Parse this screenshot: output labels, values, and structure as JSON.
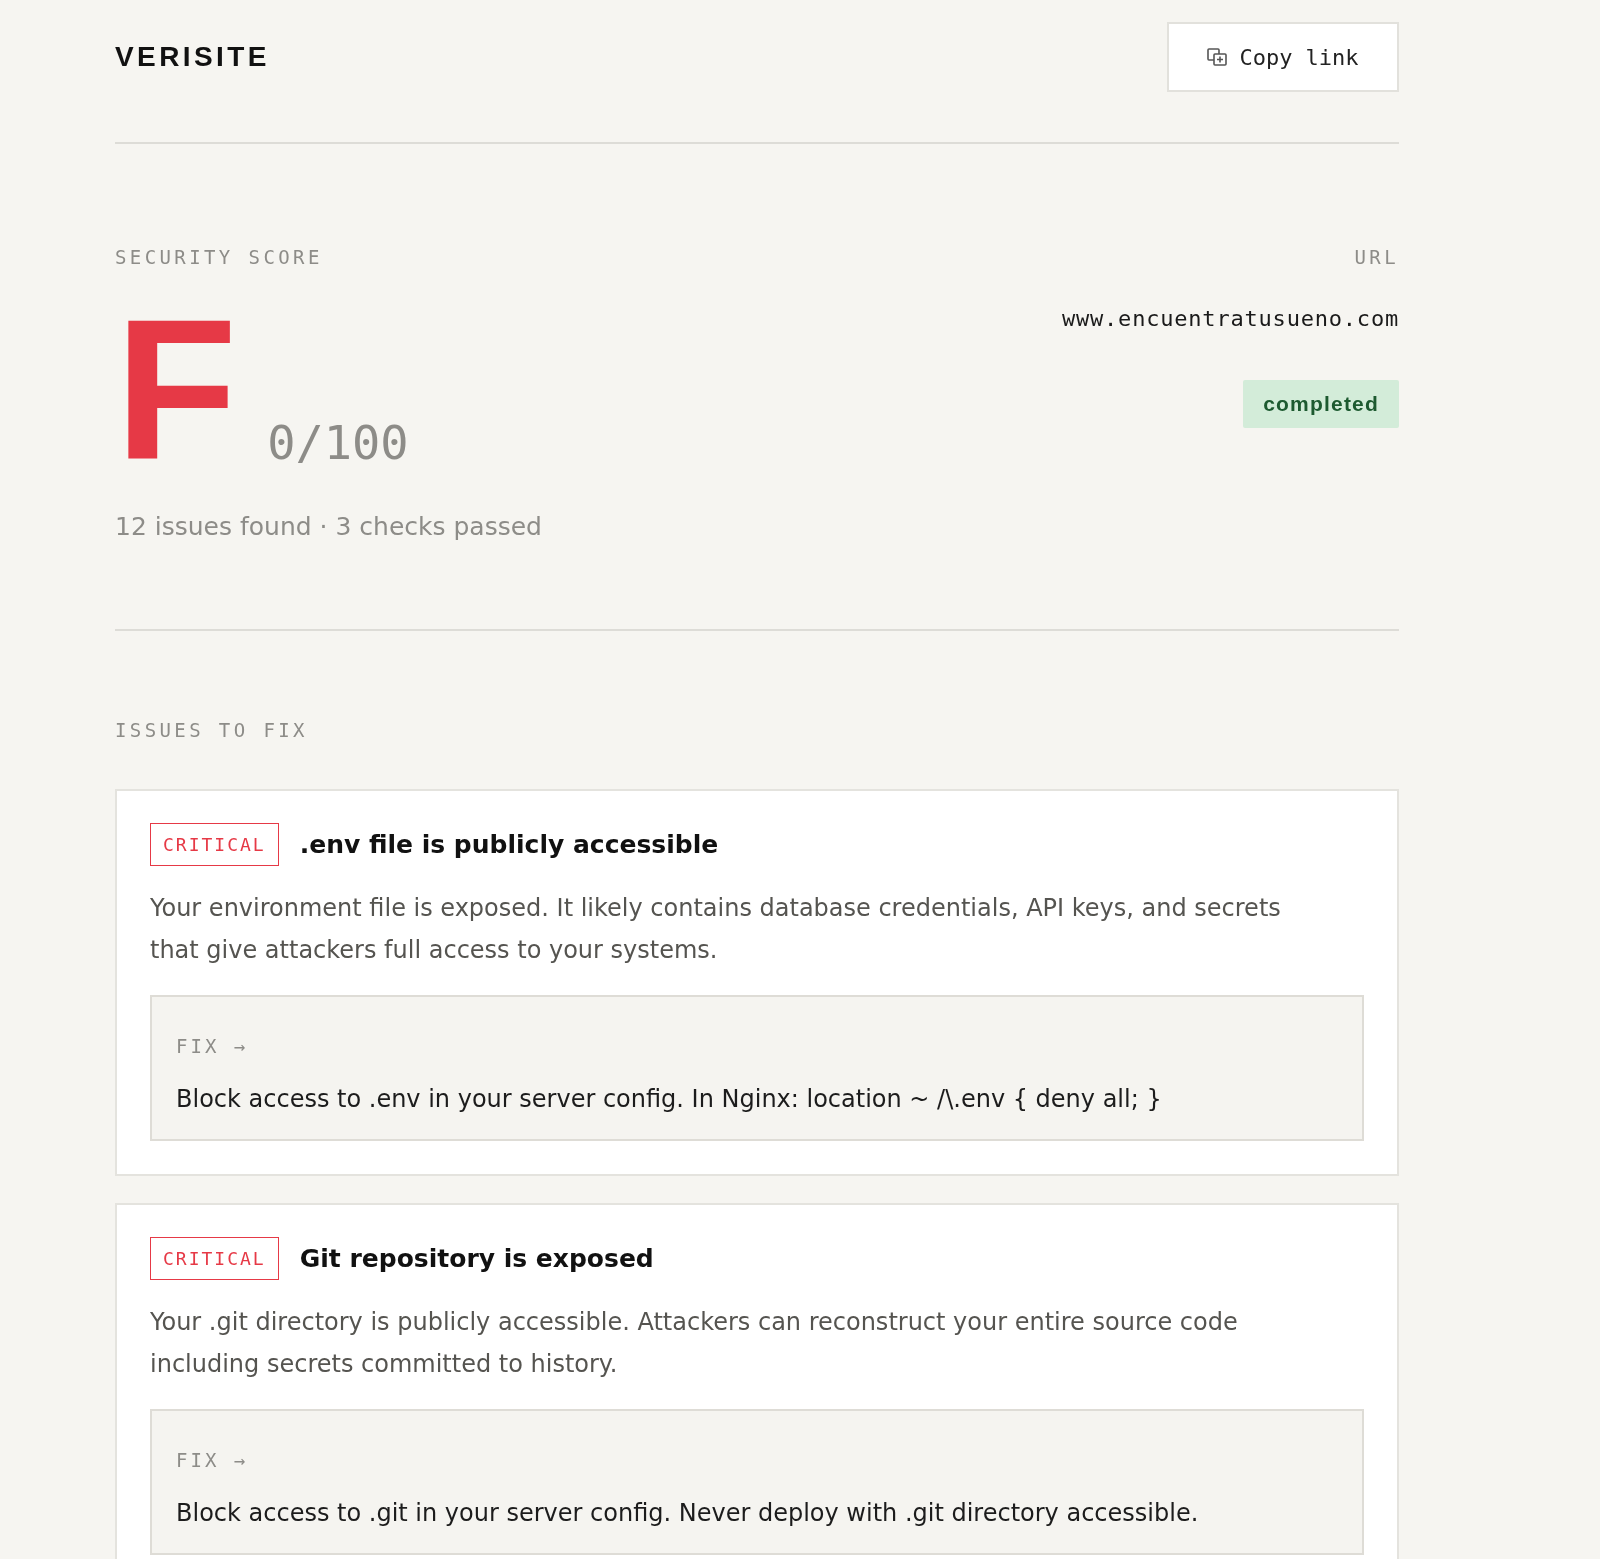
{
  "header": {
    "logo": "VERISITE",
    "copy_button": {
      "label": "Copy link"
    }
  },
  "score": {
    "label": "SECURITY SCORE",
    "grade": "F",
    "points": "0/100",
    "summary": "12 issues found · 3 checks passed"
  },
  "target": {
    "label": "URL",
    "url": "www.encuentratusueno.com",
    "status": "completed"
  },
  "issues": {
    "title": "ISSUES TO FIX",
    "items": [
      {
        "kind": "critical",
        "severity": "CRITICAL",
        "title": ".env file is publicly accessible",
        "description": "Your environment file is exposed. It likely contains database credentials, API keys, and secrets that give attackers full access to your systems.",
        "fix_label": "FIX →",
        "fix": "Block access to .env in your server config. In Nginx: location ~ /\\.env { deny all; }"
      },
      {
        "kind": "critical",
        "severity": "CRITICAL",
        "title": "Git repository is exposed",
        "description": "Your .git directory is publicly accessible. Attackers can reconstruct your entire source code including secrets committed to history.",
        "fix_label": "FIX →",
        "fix": "Block access to .git in your server config. Never deploy with .git directory accessible."
      }
    ]
  }
}
